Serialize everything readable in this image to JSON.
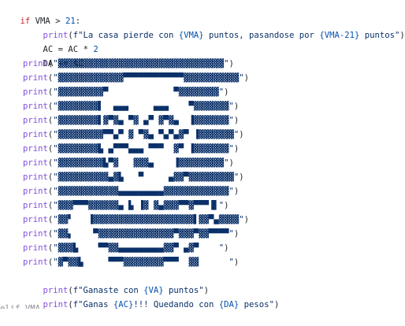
{
  "code_lines": [
    {
      "kind": "if",
      "text": "if VMA > 21:"
    },
    {
      "kind": "fstring_print",
      "text": "print(f\"La casa pierde con {VMA} puntos, pasandose por {VMA-21} puntos\")"
    },
    {
      "kind": "stmt",
      "text": "AC = AC * 2"
    },
    {
      "kind": "stmt",
      "text": "DA += AC"
    },
    {
      "kind": "art",
      "text": "print(\"▓▓▓▓▓▓▓▓▓▓▓▓▓▓▓▓▓▓▓▓▓▓▓▓▓▓▓▓▓▓▓▓▓\")"
    },
    {
      "kind": "art",
      "text": "print(\"▓▓▓▓▓▓▓▓▓▓▓▓▓▀▀▀▀▀▀▀▀▀▀▀▀▓▓▓▓▓▓▓▓▓▓▓\")"
    },
    {
      "kind": "art",
      "text": "print(\"▓▓▓▓▓▓▓▓▓▀             ▀▓▓▓▓▓▓▓▓\")"
    },
    {
      "kind": "art",
      "text": "print(\"▓▓▓▓▓▓▓▓▌  ▄▄▄     ▄▄▄    ▀▓▓▓▓▓▓▓\")"
    },
    {
      "kind": "art",
      "text": "print(\"▓▓▓▓▓▓▓▓▌▓▀▓▄ ▀▓ ▄▀ ▓▀▓▄  ▐▓▓▓▓▓▓▓\")"
    },
    {
      "kind": "art",
      "text": "print(\"▓▓▓▓▓▓▓▓▓▀▀▄▀ ▓ ▀▓▄ ▀▄▀▄▓▀ ▐▓▓▓▓▓▓▓\")"
    },
    {
      "kind": "art",
      "text": "print(\"▓▓▓▓▓▓▓▓▙ ▄▀▀▀▄▄▄ ▀▀▀  ▓▀ ▐▓▓▓▓▓▓▓\")"
    },
    {
      "kind": "art",
      "text": "print(\"▓▓▓▓▓▓▓▓▓▙▀▓   ▓▓▓▄    ▐▓▓▓▓▓▓▓▓▓\")"
    },
    {
      "kind": "art",
      "text": "print(\"▓▓▓▓▓▓▓▓▓▓▄▓▙   ▀     ▄▓▓▀▓▓▓▓▓▓▓▓▓\")"
    },
    {
      "kind": "art",
      "text": "print(\"▓▓▓▓▓▓▓▓▓▓▓▓▄▄▄▄▄▄▄▄▄▓▓▓▓▓▓▓▓▓▓▓▓▓\")"
    },
    {
      "kind": "art",
      "text": "print(\"▓▓▓▀▀▀▓▓▓▓▓▓▄ ▙ ▐▓ ▓▄▓▓▓▀▀▓▀▀▀▐▌\")"
    },
    {
      "kind": "art",
      "text": "print(\"▓▓▘   ▐▓▓▓▓▓▓▓▓▓▓▓▓▓▓▓▓▓▓▓▓▌▓▓▀▄▓▓▓▓\")"
    },
    {
      "kind": "art",
      "text": "print(\"▓▓▖    ▀▓▓▓▓▓▓▓▓▓▓▓▓▓▓▓▀▓▓▓▀▓▓▀▀▀▀\")"
    },
    {
      "kind": "art",
      "text": "print(\"▓▓▓▙    ▀▀▓▓▄▄▄▄▄▄▄▄▄▓▓▀ ▄▓▀    \")"
    },
    {
      "kind": "art",
      "text": "print(\"▓▀▓▓▙     ▀▀▀▓▓▓▓▓▓▓▓▀▀▀  ▓▓      \")"
    },
    {
      "kind": "fstring_print",
      "text": "print(f\"Ganaste con {VA} puntos\")"
    },
    {
      "kind": "fstring_print",
      "text": "print(f\"Ganas {AC}!!! Quedando con {DA} pesos\")"
    },
    {
      "kind": "cut",
      "text": "elif VMA ..."
    }
  ],
  "colors": {
    "keyword": "#cf222e",
    "function": "#8250df",
    "string": "#0a3069",
    "number": "#0550ae",
    "text": "#1f2328",
    "background": "#ffffff"
  }
}
